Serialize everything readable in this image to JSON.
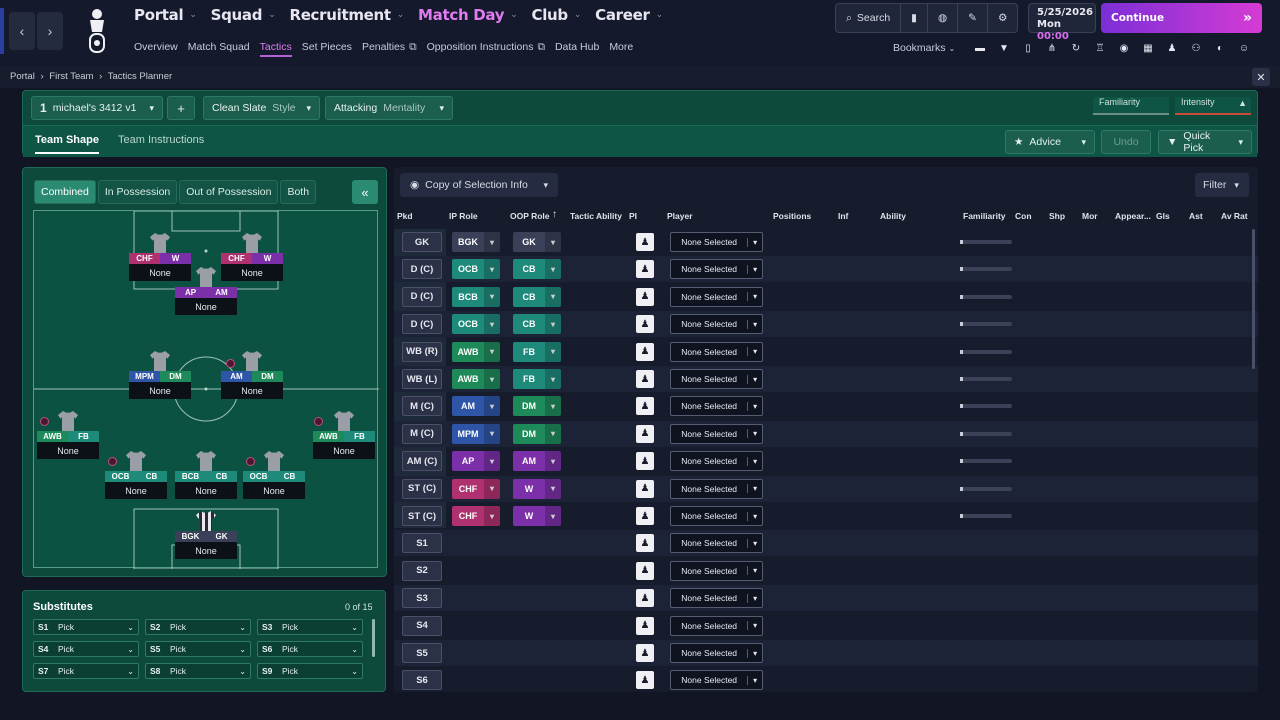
{
  "nav": {
    "main": [
      "Portal",
      "Squad",
      "Recruitment",
      "Match Day",
      "Club",
      "Career"
    ],
    "active_main": "Match Day",
    "sub": [
      "Overview",
      "Match Squad",
      "Tactics",
      "Set Pieces",
      "Penalties",
      "Opposition Instructions",
      "Data Hub",
      "More"
    ],
    "active_sub": "Tactics",
    "search_label": "Search",
    "bookmarks_label": "Bookmarks"
  },
  "date": {
    "date": "5/25/2026",
    "day": "Mon",
    "time": "00:00"
  },
  "continue_label": "Continue",
  "breadcrumb": [
    "Portal",
    "First Team",
    "Tactics Planner"
  ],
  "tactic": {
    "slot": "1",
    "name": "michael's 3412 v1",
    "add": "+",
    "style_value": "Clean Slate",
    "style_label": "Style",
    "mentality_value": "Attacking",
    "mentality_label": "Mentality",
    "familiarity_label": "Familiarity",
    "intensity_label": "Intensity",
    "tabs": [
      "Team Shape",
      "Team Instructions"
    ],
    "advice_label": "Advice",
    "undo_label": "Undo",
    "quickpick_label": "Quick Pick"
  },
  "pitch": {
    "segments": [
      "Combined",
      "In Possession",
      "Out of Possession",
      "Both"
    ],
    "active_segment": "Combined",
    "players": [
      {
        "ip": "CHF",
        "oop": "W",
        "name": "None",
        "ipc": "#b0316f",
        "oopc": "#7b2fa8"
      },
      {
        "ip": "CHF",
        "oop": "W",
        "name": "None",
        "ipc": "#b0316f",
        "oopc": "#7b2fa8"
      },
      {
        "ip": "AP",
        "oop": "AM",
        "name": "None",
        "ipc": "#7b2fa8",
        "oopc": "#7b2fa8"
      },
      {
        "ip": "MPM",
        "oop": "DM",
        "name": "None",
        "ipc": "#2e55a8",
        "oopc": "#1e8a5a"
      },
      {
        "ip": "AM",
        "oop": "DM",
        "name": "None",
        "ipc": "#2e55a8",
        "oopc": "#1e8a5a"
      },
      {
        "ip": "AWB",
        "oop": "FB",
        "name": "None",
        "ipc": "#1e8a5a",
        "oopc": "#1e8a7a"
      },
      {
        "ip": "AWB",
        "oop": "FB",
        "name": "None",
        "ipc": "#1e8a5a",
        "oopc": "#1e8a7a"
      },
      {
        "ip": "OCB",
        "oop": "CB",
        "name": "None",
        "ipc": "#1e8a7a",
        "oopc": "#1e8a7a"
      },
      {
        "ip": "BCB",
        "oop": "CB",
        "name": "None",
        "ipc": "#1e8a7a",
        "oopc": "#1e8a7a"
      },
      {
        "ip": "OCB",
        "oop": "CB",
        "name": "None",
        "ipc": "#1e8a7a",
        "oopc": "#1e8a7a"
      },
      {
        "ip": "BGK",
        "oop": "GK",
        "name": "None",
        "ipc": "#3a4058",
        "oopc": "#3a4058"
      }
    ]
  },
  "subs": {
    "title": "Substitutes",
    "count": "0 of 15",
    "slots": [
      {
        "id": "S1",
        "v": "Pick"
      },
      {
        "id": "S2",
        "v": "Pick"
      },
      {
        "id": "S3",
        "v": "Pick"
      },
      {
        "id": "S4",
        "v": "Pick"
      },
      {
        "id": "S5",
        "v": "Pick"
      },
      {
        "id": "S6",
        "v": "Pick"
      },
      {
        "id": "S7",
        "v": "Pick"
      },
      {
        "id": "S8",
        "v": "Pick"
      },
      {
        "id": "S9",
        "v": "Pick"
      }
    ]
  },
  "table": {
    "copy_label": "Copy of Selection Info",
    "filter_label": "Filter",
    "headers": [
      "Pkd",
      "IP Role",
      "OOP Role",
      "Tactic Ability",
      "PI",
      "Player",
      "Positions",
      "Inf",
      "Ability",
      "Familiarity",
      "Con",
      "Shp",
      "Mor",
      "Appear...",
      "Gls",
      "Ast",
      "Av Rat"
    ],
    "rows": [
      {
        "pos": "GK",
        "ip": "BGK",
        "oop": "GK",
        "ipc": "#3a4058",
        "oopc": "#3a4058",
        "player": "None Selected"
      },
      {
        "pos": "D (C)",
        "ip": "OCB",
        "oop": "CB",
        "ipc": "#1e8a7a",
        "oopc": "#1e8a7a",
        "player": "None Selected"
      },
      {
        "pos": "D (C)",
        "ip": "BCB",
        "oop": "CB",
        "ipc": "#1e8a7a",
        "oopc": "#1e8a7a",
        "player": "None Selected"
      },
      {
        "pos": "D (C)",
        "ip": "OCB",
        "oop": "CB",
        "ipc": "#1e8a7a",
        "oopc": "#1e8a7a",
        "player": "None Selected"
      },
      {
        "pos": "WB (R)",
        "ip": "AWB",
        "oop": "FB",
        "ipc": "#1e8a5a",
        "oopc": "#1e8a7a",
        "player": "None Selected"
      },
      {
        "pos": "WB (L)",
        "ip": "AWB",
        "oop": "FB",
        "ipc": "#1e8a5a",
        "oopc": "#1e8a7a",
        "player": "None Selected"
      },
      {
        "pos": "M (C)",
        "ip": "AM",
        "oop": "DM",
        "ipc": "#2e55a8",
        "oopc": "#1e8a5a",
        "player": "None Selected"
      },
      {
        "pos": "M (C)",
        "ip": "MPM",
        "oop": "DM",
        "ipc": "#2e55a8",
        "oopc": "#1e8a5a",
        "player": "None Selected"
      },
      {
        "pos": "AM (C)",
        "ip": "AP",
        "oop": "AM",
        "ipc": "#7b2fa8",
        "oopc": "#7b2fa8",
        "player": "None Selected"
      },
      {
        "pos": "ST (C)",
        "ip": "CHF",
        "oop": "W",
        "ipc": "#b0316f",
        "oopc": "#7b2fa8",
        "player": "None Selected"
      },
      {
        "pos": "ST (C)",
        "ip": "CHF",
        "oop": "W",
        "ipc": "#b0316f",
        "oopc": "#7b2fa8",
        "player": "None Selected"
      },
      {
        "pos": "S1",
        "player": "None Selected"
      },
      {
        "pos": "S2",
        "player": "None Selected"
      },
      {
        "pos": "S3",
        "player": "None Selected"
      },
      {
        "pos": "S4",
        "player": "None Selected"
      },
      {
        "pos": "S5",
        "player": "None Selected"
      },
      {
        "pos": "S6",
        "player": "None Selected"
      }
    ]
  }
}
